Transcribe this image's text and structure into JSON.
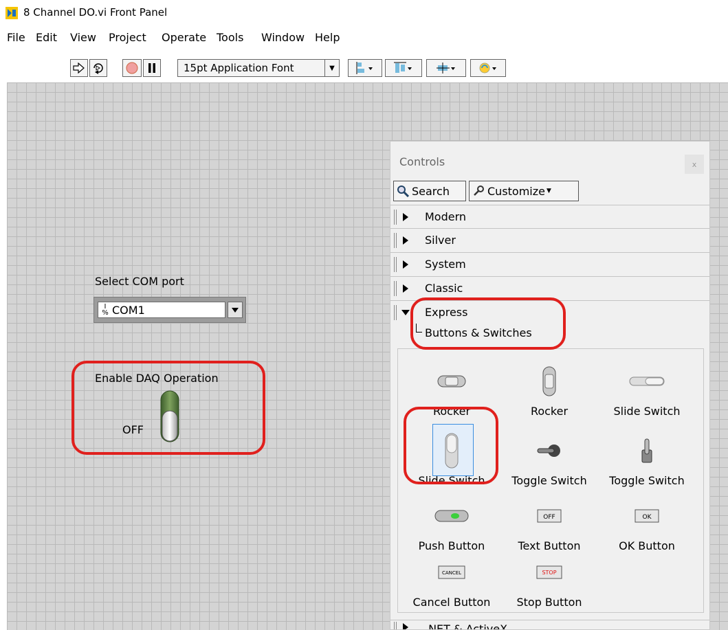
{
  "window": {
    "title": "8 Channel DO.vi Front Panel"
  },
  "menu": [
    "File",
    "Edit",
    "View",
    "Project",
    "Operate",
    "Tools",
    "Window",
    "Help"
  ],
  "toolbar": {
    "font": "15pt Application Font"
  },
  "panel": {
    "com": {
      "label": "Select COM port",
      "value": "COM1",
      "io_glyph_top": "I",
      "io_glyph_bottom": "%"
    },
    "daq": {
      "label": "Enable DAQ Operation",
      "state": "OFF"
    }
  },
  "palette": {
    "title": "Controls",
    "close": "x",
    "search": "Search",
    "customize": "Customize",
    "categories": [
      "Modern",
      "Silver",
      "System",
      "Classic"
    ],
    "express": "Express",
    "subcategory": "Buttons & Switches",
    "items": [
      {
        "label": "Rocker",
        "icon": "horizontal-rocker-icon"
      },
      {
        "label": "Rocker",
        "icon": "vertical-rocker-icon"
      },
      {
        "label": "Slide Switch",
        "icon": "horizontal-slide-switch-icon"
      },
      {
        "label": "Slide Switch",
        "icon": "vertical-slide-switch-icon"
      },
      {
        "label": "Toggle Switch",
        "icon": "horizontal-toggle-switch-icon"
      },
      {
        "label": "Toggle Switch",
        "icon": "vertical-toggle-switch-icon"
      },
      {
        "label": "Push Button",
        "icon": "push-button-icon"
      },
      {
        "label": "Text Button",
        "icon": "text-button-icon",
        "glyph_text": "OFF"
      },
      {
        "label": "OK Button",
        "icon": "ok-button-icon",
        "glyph_text": "OK"
      },
      {
        "label": "Cancel Button",
        "icon": "cancel-button-icon",
        "glyph_text": "CANCEL"
      },
      {
        "label": "Stop Button",
        "icon": "stop-button-icon",
        "glyph_text": "STOP"
      }
    ],
    "next_category": ".NET & ActiveX"
  },
  "colors": {
    "highlight": "#e0201d",
    "canvas": "#d4d4d4",
    "selection": "#3a8de0"
  }
}
